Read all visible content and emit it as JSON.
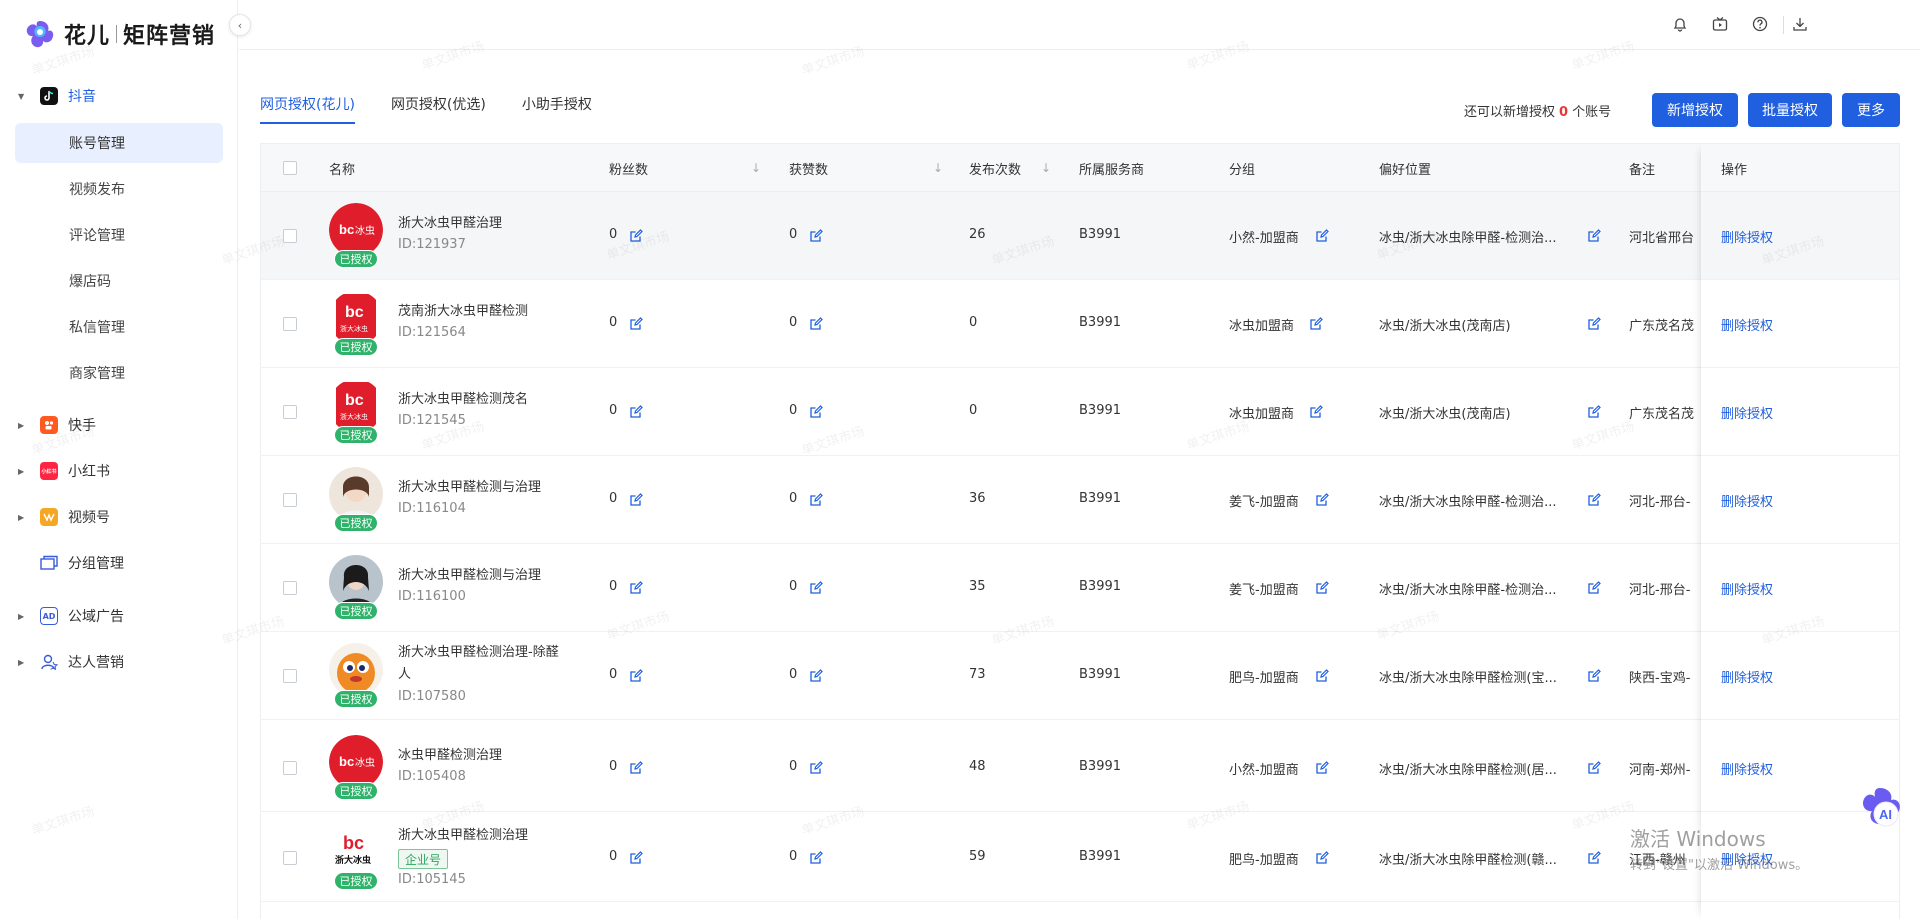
{
  "brand": {
    "name": "花儿",
    "product": "矩阵营销"
  },
  "sidebar": {
    "groups": [
      {
        "label": "抖音",
        "icon": "douyin-icon",
        "color": "#111111"
      },
      {
        "label": "快手",
        "icon": "kuaishou-icon",
        "color": "#ff5a1f"
      },
      {
        "label": "小红书",
        "icon": "xiaohongshu-icon",
        "color": "#ff2442",
        "iconText": "小红书"
      },
      {
        "label": "视频号",
        "icon": "shipinhao-icon",
        "color": "#f5a623"
      },
      {
        "label": "分组管理",
        "icon": "group-icon"
      },
      {
        "label": "公域广告",
        "icon": "ad-icon",
        "iconText": "AD"
      },
      {
        "label": "达人营销",
        "icon": "influencer-icon"
      }
    ],
    "douyin_items": [
      "账号管理",
      "视频发布",
      "评论管理",
      "爆店码",
      "私信管理",
      "商家管理"
    ]
  },
  "tabs": [
    "网页授权(花儿)",
    "网页授权(优选)",
    "小助手授权"
  ],
  "quota": {
    "prefix": "还可以新增授权",
    "count": "0",
    "suffix": "个账号"
  },
  "buttons": {
    "add": "新增授权",
    "batch": "批量授权",
    "more": "更多"
  },
  "columns": {
    "name": "名称",
    "fans": "粉丝数",
    "likes": "获赞数",
    "posts": "发布次数",
    "provider": "所属服务商",
    "group": "分组",
    "location": "偏好位置",
    "note": "备注",
    "ops": "操作"
  },
  "badge_label": "已授权",
  "delete_label": "删除授权",
  "rows": [
    {
      "name": "浙大冰虫甲醛治理",
      "id": "ID:121937",
      "fans": "0",
      "likes": "0",
      "posts": "26",
      "provider": "B3991",
      "group": "小然-加盟商",
      "location": "冰虫/浙大冰虫除甲醛-检测治...",
      "note": "河北省邢台",
      "avatar": "logo-round"
    },
    {
      "name": "茂南浙大冰虫甲醛检测",
      "id": "ID:121564",
      "fans": "0",
      "likes": "0",
      "posts": "0",
      "provider": "B3991",
      "group": "冰虫加盟商",
      "location": "冰虫/浙大冰虫(茂南店)",
      "note": "广东茂名茂",
      "avatar": "logo-square"
    },
    {
      "name": "浙大冰虫甲醛检测茂名",
      "id": "ID:121545",
      "fans": "0",
      "likes": "0",
      "posts": "0",
      "provider": "B3991",
      "group": "冰虫加盟商",
      "location": "冰虫/浙大冰虫(茂南店)",
      "note": "广东茂名茂",
      "avatar": "logo-square"
    },
    {
      "name": "浙大冰虫甲醛检测与治理",
      "id": "ID:116104",
      "fans": "0",
      "likes": "0",
      "posts": "36",
      "provider": "B3991",
      "group": "姜飞-加盟商",
      "location": "冰虫/浙大冰虫除甲醛-检测治...",
      "note": "河北-邢台-",
      "avatar": "person-light"
    },
    {
      "name": "浙大冰虫甲醛检测与治理",
      "id": "ID:116100",
      "fans": "0",
      "likes": "0",
      "posts": "35",
      "provider": "B3991",
      "group": "姜飞-加盟商",
      "location": "冰虫/浙大冰虫除甲醛-检测治...",
      "note": "河北-邢台-",
      "avatar": "person-dark"
    },
    {
      "name": "浙大冰虫甲醛检测治理-除醛",
      "name2": "人",
      "id": "ID:107580",
      "fans": "0",
      "likes": "0",
      "posts": "73",
      "provider": "B3991",
      "group": "肥鸟-加盟商",
      "location": "冰虫/浙大冰虫除甲醛检测(宝...",
      "note": "陕西-宝鸡-",
      "avatar": "mascot"
    },
    {
      "name": "冰虫甲醛检测治理",
      "id": "ID:105408",
      "fans": "0",
      "likes": "0",
      "posts": "48",
      "provider": "B3991",
      "group": "小然-加盟商",
      "location": "冰虫/浙大冰虫除甲醛检测(居...",
      "note": "河南-郑州-",
      "avatar": "logo-round"
    },
    {
      "name": "浙大冰虫甲醛检测治理",
      "ent": "企业号",
      "id": "ID:105145",
      "fans": "0",
      "likes": "0",
      "posts": "59",
      "provider": "B3991",
      "group": "肥鸟-加盟商",
      "location": "冰虫/浙大冰虫除甲醛检测(赣...",
      "note": "江西-赣州",
      "avatar": "logo-plain"
    }
  ],
  "watermark": "单文琪市场",
  "os_notice": {
    "title": "激活 Windows",
    "subtitle": "转到\"设置\"以激活 Windows。"
  }
}
